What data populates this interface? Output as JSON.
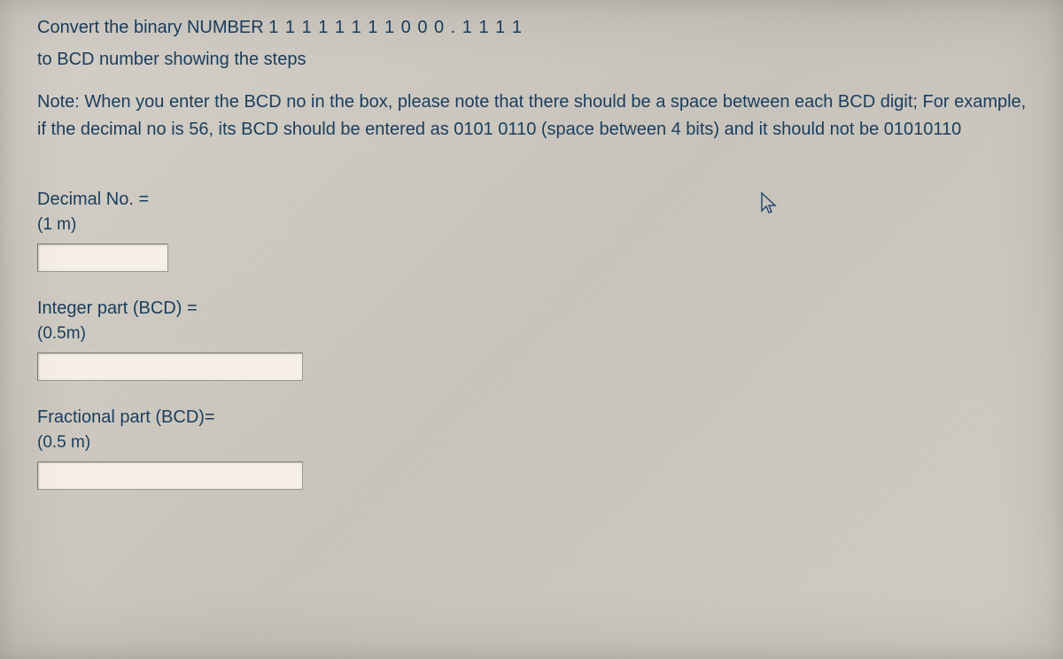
{
  "question": {
    "line1_prefix": "Convert the binary NUMBER ",
    "binary_number": "1 1 1 1 1 1 1 1 0 0 0 . 1 1 1 1",
    "line2": "to BCD number showing the steps",
    "note": "Note: When you enter the BCD no in the box, please note that there should be a space between each BCD digit; For example, if the decimal no is  56, its BCD should be entered as 0101 0110  (space between 4 bits) and it should not be 01010110"
  },
  "fields": {
    "decimal": {
      "label": "Decimal No. =",
      "marks": "(1 m)",
      "value": ""
    },
    "integer_bcd": {
      "label": "Integer part (BCD) =",
      "marks": "(0.5m)",
      "value": ""
    },
    "fractional_bcd": {
      "label": "Fractional part (BCD)=",
      "marks": "(0.5 m)",
      "value": ""
    }
  }
}
